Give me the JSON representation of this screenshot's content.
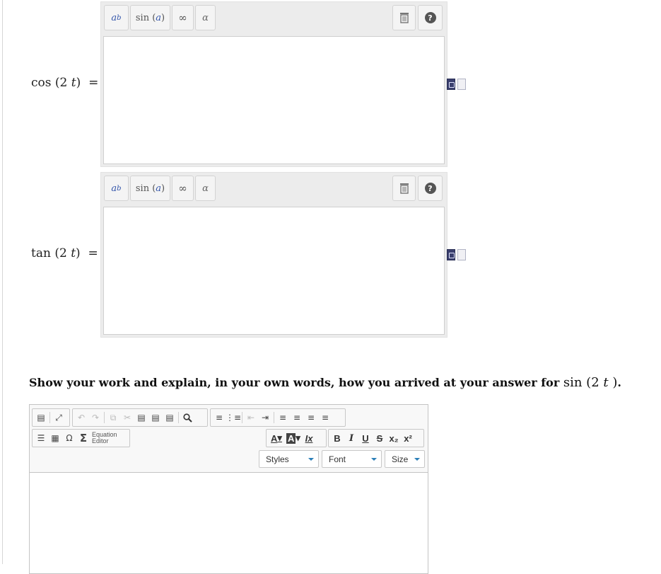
{
  "equations": [
    {
      "fn": "cos",
      "arg_num": "2",
      "arg_var": "t",
      "equals": "="
    },
    {
      "fn": "tan",
      "arg_num": "2",
      "arg_var": "t",
      "equals": "="
    }
  ],
  "math_toolbar": {
    "power_base": "a",
    "power_exp": "b",
    "sin_fn": "sin",
    "sin_arg": "a",
    "infinity": "∞",
    "alpha": "α",
    "help": "?"
  },
  "question": {
    "text": "Show your work and explain, in your own words, how you arrived at your answer for",
    "fn": "sin",
    "arg_num": "2",
    "arg_var": "t",
    "end": "."
  },
  "rich_editor": {
    "equation_editor_line1": "Equation",
    "equation_editor_line2": "Editor",
    "omega": "Ω",
    "sigma": "Σ",
    "bold": "B",
    "italic": "I",
    "underline": "U",
    "strike": "S",
    "subscript": "x₂",
    "superscript": "x²",
    "text_color": "A",
    "bg_color": "A",
    "clear_format": "Ix",
    "styles_label": "Styles",
    "font_label": "Font",
    "size_label": "Size"
  }
}
